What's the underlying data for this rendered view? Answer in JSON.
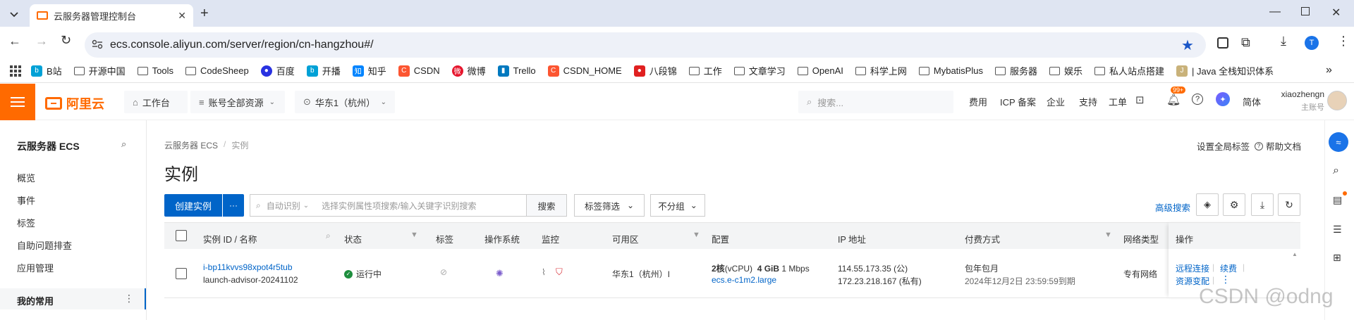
{
  "browser": {
    "tab_title": "云服务器管理控制台",
    "url": "ecs.console.aliyun.com/server/region/cn-hangzhou#/",
    "profile_initial": "T",
    "bookmarks": [
      "B站",
      "开源中国",
      "Tools",
      "CodeSheep",
      "百度",
      "开播",
      "知乎",
      "CSDN",
      "微博",
      "Trello",
      "CSDN_HOME",
      "八段锦",
      "工作",
      "文章学习",
      "OpenAI",
      "科学上网",
      "MybatisPlus",
      "服务器",
      "娱乐",
      "私人站点搭建",
      "| Java 全栈知识体系"
    ],
    "more_bookmarks": "»"
  },
  "header": {
    "logo_text": "阿里云",
    "workbench": "工作台",
    "account_resources": "账号全部资源",
    "region": "华东1（杭州）",
    "search_placeholder": "搜索...",
    "links": [
      "费用",
      "ICP 备案",
      "企业",
      "支持",
      "工单"
    ],
    "badge": "99+",
    "lang": "简体",
    "username": "xiaozhengn",
    "account_type": "主账号"
  },
  "sidebar": {
    "title": "云服务器 ECS",
    "items": [
      "概览",
      "事件",
      "标签",
      "自助问题排查",
      "应用管理"
    ],
    "favorites": "我的常用"
  },
  "main": {
    "breadcrumb_root": "云服务器 ECS",
    "breadcrumb_sep": "/",
    "breadcrumb_current": "实例",
    "global_tags": "设置全局标签",
    "help_docs": "帮助文档",
    "page_title": "实例",
    "create_button": "创建实例",
    "more_button": "···",
    "auto_identify": "自动识别",
    "search_placeholder": "选择实例属性项搜索/输入关键字识别搜索",
    "search_button": "搜索",
    "tag_filter": "标签筛选",
    "group": "不分组",
    "advanced_search": "高级搜索"
  },
  "table": {
    "headers": [
      "实例 ID / 名称",
      "状态",
      "标签",
      "操作系统",
      "监控",
      "可用区",
      "配置",
      "IP 地址",
      "付费方式",
      "网络类型",
      "操作"
    ],
    "row": {
      "instance_id": "i-bp11kvvs98xpot4r5tub",
      "instance_name": "launch-advisor-20241102",
      "status": "运行中",
      "zone": "华东1（杭州）I",
      "cpu": "2核",
      "cpu_unit": "(vCPU)",
      "mem": "4 GiB",
      "bandwidth": "1 Mbps",
      "spec": "ecs.e-c1m2.large",
      "ip_public": "114.55.173.35 (公)",
      "ip_private": "172.23.218.167 (私有)",
      "billing": "包年包月",
      "expire": "2024年12月2日 23:59:59到期",
      "network": "专有网络",
      "action_remote": "远程连接",
      "action_renew": "续费",
      "action_change": "资源变配"
    }
  },
  "watermark": "CSDN @odng",
  "colors": {
    "brand_orange": "#ff6a00",
    "primary_blue": "#0064c8",
    "status_green": "#1e8e3e"
  }
}
